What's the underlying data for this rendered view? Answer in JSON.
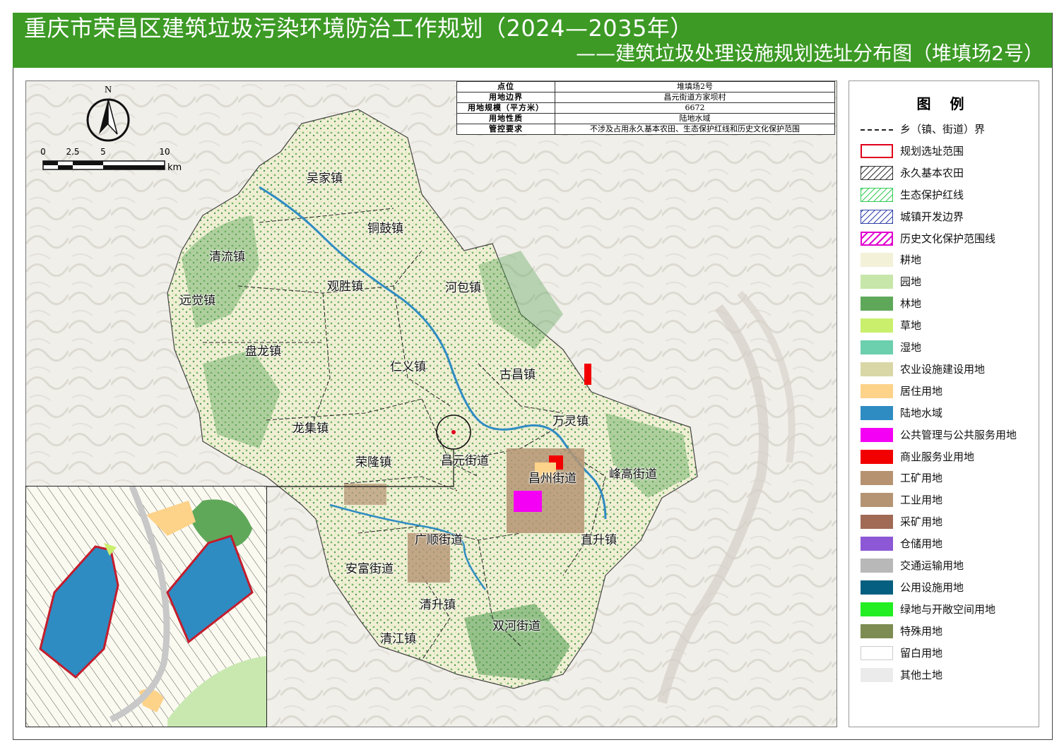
{
  "header": {
    "title": "重庆市荣昌区建筑垃圾污染环境防治工作规划（2024—2035年）",
    "subtitle": "——建筑垃圾处理设施规划选址分布图（堆填场2号）"
  },
  "info_table": {
    "rows": [
      {
        "key": "点位",
        "value": "堆填场2号"
      },
      {
        "key": "用地边界",
        "value": "昌元街道方家坝村"
      },
      {
        "key": "用地规模（平方米）",
        "value": "6672"
      },
      {
        "key": "用地性质",
        "value": "陆地水域"
      },
      {
        "key": "管控要求",
        "value": "不涉及占用永久基本农田、生态保护红线和历史文化保护范围"
      }
    ]
  },
  "north_arrow": {
    "label": "N"
  },
  "scale_bar": {
    "ticks": [
      "0",
      "2.5",
      "5",
      "10"
    ],
    "unit": "km"
  },
  "map": {
    "place_names": [
      "吴家镇",
      "铜鼓镇",
      "清流镇",
      "观胜镇",
      "河包镇",
      "远觉镇",
      "盘龙镇",
      "仁义镇",
      "古昌镇",
      "万灵镇",
      "龙集镇",
      "荣隆镇",
      "昌元街道",
      "昌州街道",
      "峰高街道",
      "广顺街道",
      "直升镇",
      "安富街道",
      "清升镇",
      "双河街道",
      "清江镇"
    ]
  },
  "legend": {
    "title": "图  例",
    "items": [
      {
        "label": "乡（镇、街道）界",
        "kind": "line",
        "color": "#222222"
      },
      {
        "label": "规划选址范围",
        "kind": "outline",
        "color": "#e0001b"
      },
      {
        "label": "永久基本农田",
        "kind": "hatch",
        "color": "#333333"
      },
      {
        "label": "生态保护红线",
        "kind": "hatch",
        "color": "#33cc55"
      },
      {
        "label": "城镇开发边界",
        "kind": "hatch",
        "color": "#3344aa"
      },
      {
        "label": "历史文化保护范围线",
        "kind": "hatch-outline",
        "color": "#e000d0"
      },
      {
        "label": "耕地",
        "kind": "fill",
        "color": "#f3f1d8"
      },
      {
        "label": "园地",
        "kind": "fill",
        "color": "#c7e6a9"
      },
      {
        "label": "林地",
        "kind": "fill",
        "color": "#5fa85a"
      },
      {
        "label": "草地",
        "kind": "fill",
        "color": "#c9ef6d"
      },
      {
        "label": "湿地",
        "kind": "fill",
        "color": "#6ccfae"
      },
      {
        "label": "农业设施建设用地",
        "kind": "fill",
        "color": "#d9d7a6"
      },
      {
        "label": "居住用地",
        "kind": "fill",
        "color": "#fdd289"
      },
      {
        "label": "陆地水域",
        "kind": "fill",
        "color": "#2f8cc2"
      },
      {
        "label": "公共管理与公共服务用地",
        "kind": "fill",
        "color": "#f400f4"
      },
      {
        "label": "商业服务业用地",
        "kind": "fill",
        "color": "#f20000"
      },
      {
        "label": "工矿用地",
        "kind": "fill",
        "color": "#b69270"
      },
      {
        "label": "工业用地",
        "kind": "fill",
        "color": "#b59473"
      },
      {
        "label": "采矿用地",
        "kind": "fill",
        "color": "#a06a55"
      },
      {
        "label": "仓储用地",
        "kind": "fill",
        "color": "#8c58d6"
      },
      {
        "label": "交通运输用地",
        "kind": "fill",
        "color": "#b8b8b8"
      },
      {
        "label": "公用设施用地",
        "kind": "fill",
        "color": "#045f80"
      },
      {
        "label": "绿地与开敞空间用地",
        "kind": "fill",
        "color": "#22ee22"
      },
      {
        "label": "特殊用地",
        "kind": "fill",
        "color": "#7d8c52"
      },
      {
        "label": "留白用地",
        "kind": "fill",
        "color": "#ffffff"
      },
      {
        "label": "其他土地",
        "kind": "fill",
        "color": "#ebebeb"
      }
    ]
  }
}
